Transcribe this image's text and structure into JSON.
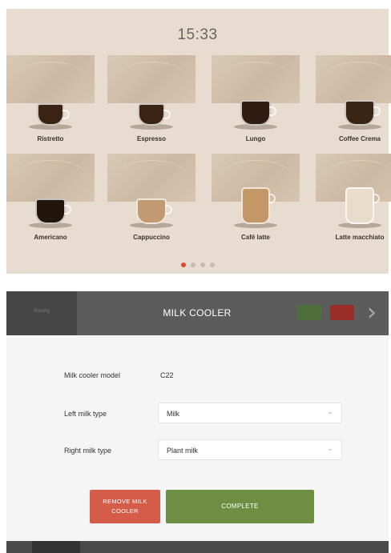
{
  "menu": {
    "clock": "15:33",
    "drinks": [
      {
        "label": "Ristretto",
        "cup": "small",
        "fill": "#3b2313"
      },
      {
        "label": "Espresso",
        "cup": "small",
        "fill": "#3b2313"
      },
      {
        "label": "Lungo",
        "cup": "mid",
        "fill": "#2f1b0f"
      },
      {
        "label": "Coffee Crema",
        "cup": "mid",
        "fill": "#3a2414"
      },
      {
        "label": "Americano",
        "cup": "mid",
        "fill": "#22150c"
      },
      {
        "label": "Cappuccino",
        "cup": "mid",
        "fill": "#c29a72"
      },
      {
        "label": "Café latte",
        "cup": "tall",
        "fill": "#c49866"
      },
      {
        "label": "Latte macchiato",
        "cup": "tall",
        "fill": "#e8dccb"
      }
    ],
    "pages": 4,
    "active_page": 1,
    "colors": {
      "active_dot": "#e0453a",
      "background": "#e8dcd0"
    }
  },
  "cooler": {
    "side_tab_label": "Rinsing",
    "title": "MILK COOLER",
    "header_icons": [
      "green-status-icon",
      "red-status-icon",
      "chevron-right-icon"
    ],
    "fields": {
      "model_label": "Milk cooler model",
      "model_value": "C22",
      "left_label": "Left milk type",
      "left_value": "Milk",
      "right_label": "Right milk type",
      "right_value": "Plant milk"
    },
    "buttons": {
      "remove_line1": "REMOVE MILK",
      "remove_line2": "COOLER",
      "complete": "COMPLETE"
    },
    "colors": {
      "remove": "#d65c4a",
      "complete": "#6e8f43",
      "header": "#5c5c5c"
    }
  }
}
